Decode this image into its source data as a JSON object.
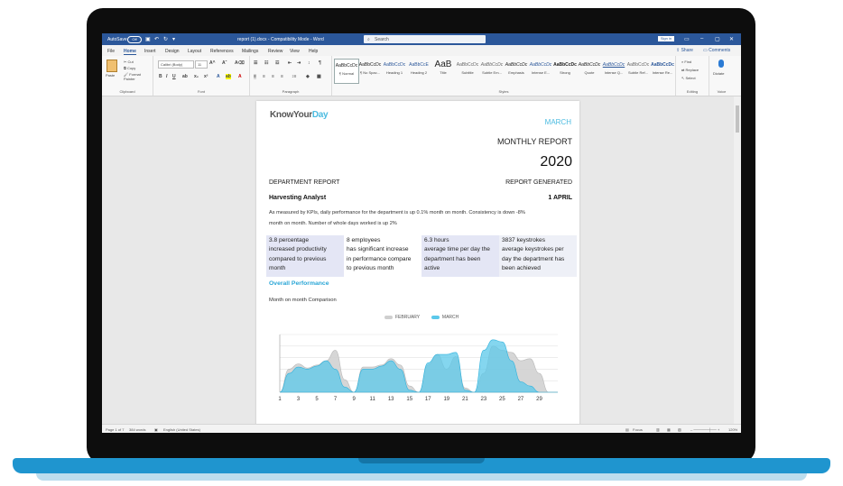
{
  "window": {
    "autosave_label": "AutoSave",
    "autosave_state": "Off",
    "title": "report (1).docx  -  Compatibility Mode  -  Word",
    "search_placeholder": "Search",
    "signin_label": "Sign in"
  },
  "tabs": [
    "File",
    "Home",
    "Insert",
    "Design",
    "Layout",
    "References",
    "Mailings",
    "Review",
    "View",
    "Help"
  ],
  "active_tab": "Home",
  "share_label": "Share",
  "comments_label": "Comments",
  "ribbon": {
    "clipboard": {
      "paste": "Paste",
      "cut": "Cut",
      "copy": "Copy",
      "format_painter": "Format Painter",
      "group": "Clipboard"
    },
    "font": {
      "font_name": "Calibri (Body)",
      "font_size": "11",
      "group": "Font"
    },
    "paragraph": {
      "group": "Paragraph"
    },
    "styles": {
      "group": "Styles",
      "items": [
        {
          "preview": "AaBbCcDc",
          "name": "¶ Normal"
        },
        {
          "preview": "AaBbCcDc",
          "name": "¶ No Spac..."
        },
        {
          "preview": "AaBbCcDc",
          "name": "Heading 1"
        },
        {
          "preview": "AaBbCcE",
          "name": "Heading 2"
        },
        {
          "preview": "AaB",
          "name": "Title"
        },
        {
          "preview": "AaBbCcDc",
          "name": "Subtitle"
        },
        {
          "preview": "AaBbCcDc",
          "name": "Subtle Em..."
        },
        {
          "preview": "AaBbCcDc",
          "name": "Emphasis"
        },
        {
          "preview": "AaBbCcDc",
          "name": "Intense E..."
        },
        {
          "preview": "AaBbCcDc",
          "name": "Strong"
        },
        {
          "preview": "AaBbCcDc",
          "name": "Quote"
        },
        {
          "preview": "AaBbCcDc",
          "name": "Intense Q..."
        },
        {
          "preview": "AaBbCcDc",
          "name": "Subtle Ref..."
        },
        {
          "preview": "AaBbCcDc",
          "name": "Intense Re..."
        }
      ]
    },
    "editing": {
      "find": "Find",
      "replace": "Replace",
      "select": "Select",
      "group": "Editing"
    },
    "voice": {
      "dictate": "Dictate",
      "group": "Voice"
    }
  },
  "document": {
    "logo_part1": "KnowYour",
    "logo_part2": "Day",
    "month": "MARCH",
    "report_title": "MONTHLY REPORT",
    "year": "2020",
    "department_label": "DEPARTMENT REPORT",
    "generated_label": "REPORT GENERATED",
    "role": "Harvesting Analyst",
    "generated_date": "1 APRIL",
    "summary_line1": "As measured by KPIs, daily performance for the department is up 0.1% month on month. Consistency is down -8%",
    "summary_line2": "month on month. Number of whole days worked is up 2%",
    "kpis": [
      {
        "value": "3.8 percentage",
        "l1": "increased productivity",
        "l2": "compared to previous",
        "l3": "month"
      },
      {
        "value": "8 employees",
        "l1": "has significant increase",
        "l2": "in performance compare",
        "l3": "to previous month"
      },
      {
        "value": "6.3 hours",
        "l1": "average time per day the",
        "l2": "department has been",
        "l3": "active"
      },
      {
        "value": "3837 keystrokes",
        "l1": "average keystrokes per",
        "l2": "day the department has",
        "l3": "been achieved"
      }
    ],
    "section_heading": "Overall Performance",
    "chart_caption": "Month on month Comparison"
  },
  "chart_data": {
    "type": "area",
    "x": [
      1,
      2,
      3,
      4,
      5,
      6,
      7,
      8,
      9,
      10,
      11,
      12,
      13,
      14,
      15,
      16,
      17,
      18,
      19,
      20,
      21,
      22,
      23,
      24,
      25,
      26,
      27,
      28,
      29,
      30,
      31
    ],
    "x_tick_labels": [
      "1",
      "3",
      "5",
      "7",
      "9",
      "11",
      "13",
      "15",
      "17",
      "19",
      "21",
      "23",
      "25",
      "27",
      "29"
    ],
    "series": [
      {
        "name": "FEBRUARY",
        "color": "#cfcfcf",
        "values": [
          0,
          22,
          27,
          23,
          26,
          30,
          40,
          12,
          0,
          24,
          24,
          26,
          32,
          26,
          6,
          0,
          26,
          36,
          22,
          34,
          4,
          0,
          18,
          44,
          40,
          38,
          30,
          32,
          18,
          0,
          0
        ]
      },
      {
        "name": "MARCH",
        "color": "#5bc8ea",
        "values": [
          0,
          18,
          24,
          22,
          25,
          30,
          22,
          5,
          0,
          22,
          22,
          25,
          30,
          22,
          2,
          0,
          28,
          36,
          36,
          38,
          2,
          0,
          40,
          50,
          48,
          30,
          10,
          6,
          0,
          0,
          0
        ]
      }
    ],
    "ylim": [
      0,
      55
    ],
    "grid": true,
    "legend": "top-center"
  },
  "status": {
    "page": "Page 1 of 7",
    "words": "384 words",
    "language": "English (United States)",
    "focus": "Focus",
    "zoom": "120%"
  }
}
